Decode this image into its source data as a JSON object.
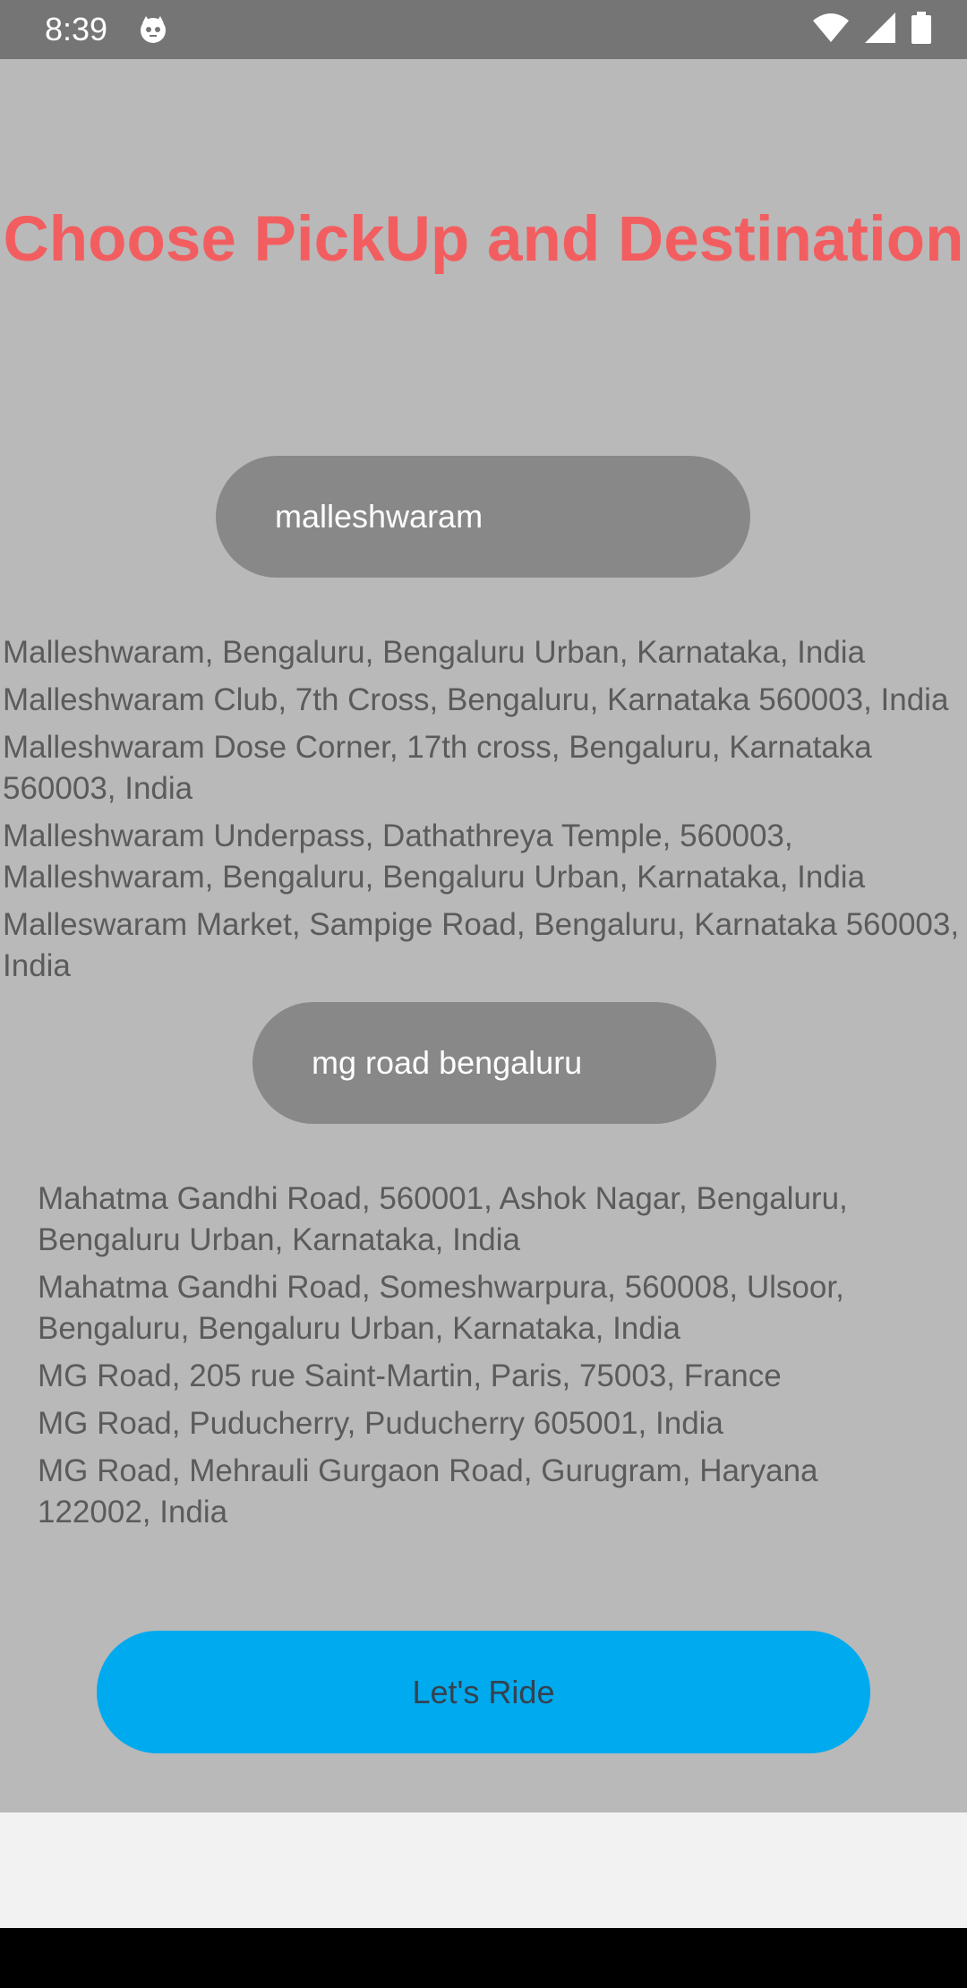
{
  "status_bar": {
    "time": "8:39",
    "app_icon": "cat-face-icon",
    "icons": [
      "wifi-icon",
      "cellular-signal-icon",
      "battery-icon"
    ]
  },
  "page": {
    "title": "Choose PickUp and Destination"
  },
  "pickup": {
    "value": "malleshwaram",
    "suggestions": [
      "Malleshwaram, Bengaluru, Bengaluru Urban, Karnataka, India",
      "Malleshwaram Club, 7th Cross, Bengaluru, Karnataka 560003, India",
      "Malleshwaram Dose Corner, 17th cross, Bengaluru, Karnataka 560003, India",
      "Malleshwaram Underpass, Dathathreya Temple, 560003, Malleshwaram, Bengaluru, Bengaluru Urban, Karnataka, India",
      "Malleswaram Market, Sampige Road, Bengaluru, Karnataka 560003, India"
    ]
  },
  "destination": {
    "value": "mg road bengaluru",
    "suggestions": [
      "Mahatma Gandhi Road, 560001, Ashok Nagar, Bengaluru, Bengaluru Urban, Karnataka, India",
      "Mahatma Gandhi Road, Someshwarpura, 560008, Ulsoor, Bengaluru, Bengaluru Urban, Karnataka, India",
      "MG Road, 205 rue Saint-Martin, Paris, 75003, France",
      "MG Road, Puducherry, Puducherry 605001, India",
      "MG Road, Mehrauli Gurgaon Road, Gurugram, Haryana 122002, India"
    ]
  },
  "actions": {
    "ride_label": "Let's Ride"
  },
  "colors": {
    "title": "#f25e60",
    "background": "#b9b9b9",
    "input": "#888888",
    "button": "#00aaee",
    "status_bar": "#757575"
  }
}
